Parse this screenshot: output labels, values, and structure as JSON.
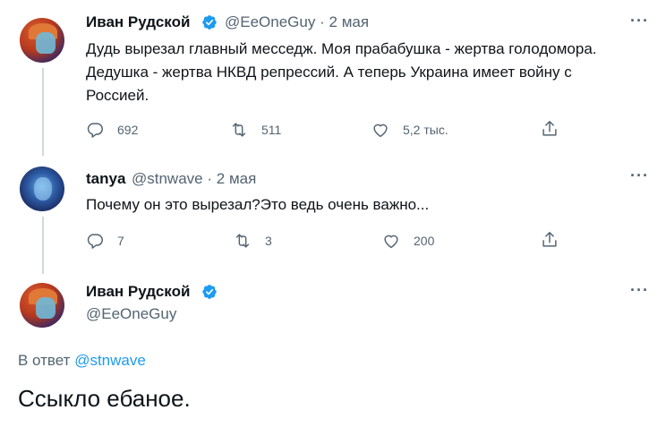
{
  "tweet1": {
    "name": "Иван Рудской",
    "handle": "@EeOneGuy",
    "separator": "·",
    "date": "2 мая",
    "more": "···",
    "text_line1": "Дудь вырезал главный месседж. Моя прабабушка - жертва голодомора.",
    "text_line2": "Дедушка - жертва НКВД репрессий. А теперь Украина имеет войну с",
    "text_line3": "Россией.",
    "replies": "692",
    "retweets": "511",
    "likes": "5,2 тыс."
  },
  "tweet2": {
    "name": "tanya",
    "handle": "@stnwave",
    "separator": "·",
    "date": "2 мая",
    "more": "···",
    "text": "Почему он это вырезал?Это ведь очень важно...",
    "replies": "7",
    "retweets": "3",
    "likes": "200"
  },
  "tweet3": {
    "name": "Иван Рудской",
    "handle": "@EeOneGuy",
    "more": "···",
    "reply_prefix": "В ответ",
    "reply_mention": "@stnwave",
    "text": "Ссыкло ебаное."
  },
  "colors": {
    "text": "#0f1419",
    "secondary": "#536471",
    "accent": "#1d9bf0",
    "verified": "#1d9bf0",
    "line": "#cfd9de"
  },
  "icons": [
    "reply-icon",
    "retweet-icon",
    "like-icon",
    "share-icon",
    "verified-icon",
    "more-icon"
  ]
}
